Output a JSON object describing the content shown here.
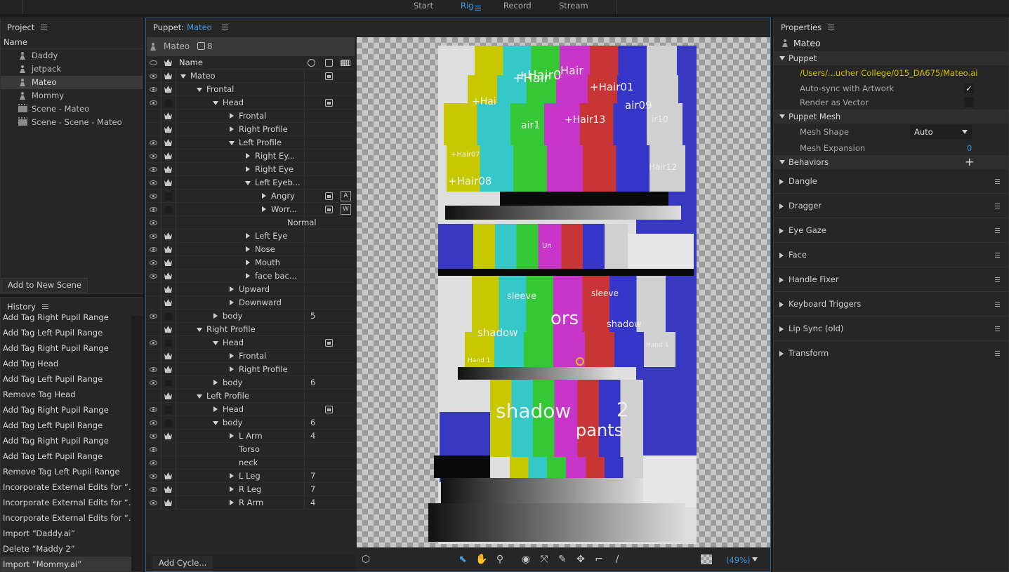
{
  "workspaces": [
    "Start",
    "Rig",
    "Record",
    "Stream"
  ],
  "project": {
    "title": "Project",
    "column": "Name",
    "items": [
      {
        "name": "Daddy",
        "kind": "puppet"
      },
      {
        "name": "jetpack",
        "kind": "puppet"
      },
      {
        "name": "Mateo",
        "kind": "puppet",
        "selected": true
      },
      {
        "name": "Mommy",
        "kind": "puppet"
      },
      {
        "name": "Scene - Mateo",
        "kind": "scene"
      },
      {
        "name": "Scene - Scene - Mateo",
        "kind": "scene"
      }
    ],
    "add_button": "Add to New Scene"
  },
  "history": {
    "title": "History",
    "items": [
      "Add Tag Right Pupil Range",
      "Add Tag Left Pupil Range",
      "Add Tag Right Pupil Range",
      "Add Tag Head",
      "Add Tag Left Pupil Range",
      "Remove Tag Head",
      "Add Tag Right Pupil Range",
      "Add Tag Left Pupil Range",
      "Add Tag Right Pupil Range",
      "Add Tag Left Pupil Range",
      "Remove Tag Left Pupil Range",
      "Incorporate External Edits for “...",
      "Incorporate External Edits for “...",
      "Incorporate External Edits for “...",
      "Import “Daddy.ai”",
      "Delete “Maddy 2”",
      "Import “Mommy.ai”"
    ]
  },
  "puppet_panel": {
    "title_prefix": "Puppet:",
    "title_name": "Mateo",
    "header_name": "Mateo",
    "header_count": "8",
    "column": "Name",
    "add_cycle": "Add Cycle...",
    "zoom": "(49%)"
  },
  "tree": [
    {
      "name": "Mateo",
      "level": 0,
      "exp": "d",
      "eye": true,
      "crown": true,
      "tag": true
    },
    {
      "name": "Frontal",
      "level": 1,
      "exp": "d",
      "eye": true,
      "crown": true
    },
    {
      "name": "Head",
      "level": 2,
      "exp": "d",
      "eye": true,
      "crown": false,
      "tag": true
    },
    {
      "name": "Frontal",
      "level": 3,
      "exp": "r",
      "eye": false,
      "crown": true
    },
    {
      "name": "Right Profile",
      "level": 3,
      "exp": "r",
      "eye": false,
      "crown": true
    },
    {
      "name": "Left Profile",
      "level": 3,
      "exp": "d",
      "eye": true,
      "crown": true
    },
    {
      "name": "Right Ey...",
      "level": 4,
      "exp": "r",
      "eye": true,
      "crown": true
    },
    {
      "name": "Right Eye",
      "level": 4,
      "exp": "r",
      "eye": true,
      "crown": true
    },
    {
      "name": "Left Eyeb...",
      "level": 4,
      "exp": "d",
      "eye": true,
      "crown": true
    },
    {
      "name": "Angry",
      "level": 5,
      "exp": "r",
      "eye": true,
      "crown": false,
      "tag": true,
      "key": "A"
    },
    {
      "name": "Worr...",
      "level": 5,
      "exp": "r",
      "eye": true,
      "crown": false,
      "tag": true,
      "key": "W"
    },
    {
      "name": "Normal",
      "level": 6,
      "exp": "",
      "eye": true,
      "crown": null
    },
    {
      "name": "Left Eye",
      "level": 4,
      "exp": "r",
      "eye": true,
      "crown": true
    },
    {
      "name": "Nose",
      "level": 4,
      "exp": "r",
      "eye": true,
      "crown": true
    },
    {
      "name": "Mouth",
      "level": 4,
      "exp": "r",
      "eye": true,
      "crown": true
    },
    {
      "name": "face bac...",
      "level": 4,
      "exp": "r",
      "eye": true,
      "crown": true
    },
    {
      "name": "Upward",
      "level": 3,
      "exp": "r",
      "eye": false,
      "crown": true
    },
    {
      "name": "Downward",
      "level": 3,
      "exp": "r",
      "eye": false,
      "crown": true
    },
    {
      "name": "body",
      "level": 2,
      "exp": "r",
      "eye": true,
      "crown": false,
      "num": "5"
    },
    {
      "name": "Right Profile",
      "level": 1,
      "exp": "d",
      "eye": false,
      "crown": true
    },
    {
      "name": "Head",
      "level": 2,
      "exp": "d",
      "eye": true,
      "crown": false,
      "tag": true
    },
    {
      "name": "Frontal",
      "level": 3,
      "exp": "r",
      "eye": false,
      "crown": true
    },
    {
      "name": "Right Profile",
      "level": 3,
      "exp": "r",
      "eye": true,
      "crown": true
    },
    {
      "name": "body",
      "level": 2,
      "exp": "r",
      "eye": true,
      "crown": false,
      "num": "6"
    },
    {
      "name": "Left Profile",
      "level": 1,
      "exp": "d",
      "eye": false,
      "crown": true
    },
    {
      "name": "Head",
      "level": 2,
      "exp": "r",
      "eye": true,
      "crown": false,
      "tag": true
    },
    {
      "name": "body",
      "level": 2,
      "exp": "d",
      "eye": true,
      "crown": false,
      "num": "6"
    },
    {
      "name": "L Arm",
      "level": 3,
      "exp": "r",
      "eye": true,
      "crown": true,
      "num": "4"
    },
    {
      "name": "Torso",
      "level": 3,
      "exp": "",
      "eye": true,
      "crown": null
    },
    {
      "name": "neck",
      "level": 3,
      "exp": "",
      "eye": true,
      "crown": null
    },
    {
      "name": "L Leg",
      "level": 3,
      "exp": "r",
      "eye": true,
      "crown": true,
      "num": "7"
    },
    {
      "name": "R Leg",
      "level": 3,
      "exp": "r",
      "eye": true,
      "crown": true,
      "num": "7"
    },
    {
      "name": "R Arm",
      "level": 3,
      "exp": "r",
      "eye": true,
      "crown": true,
      "num": "4"
    }
  ],
  "canvas_labels": [
    "+Hair",
    "+Hair0",
    "Hair",
    "+Hair01",
    "+Hai",
    "air09",
    "+Hair13",
    "air1",
    "ir10",
    "+Hair08",
    "+Hair07",
    "Hair12",
    "sleeve",
    "sleeve",
    "ors",
    "shadow",
    "shadow",
    "Hand 1",
    "Hand 1",
    "shadow",
    "2",
    "pants",
    "Un"
  ],
  "properties": {
    "title": "Properties",
    "name": "Mateo",
    "puppet_section": "Puppet",
    "path": "/Users/...ucher College/015_DA675/Mateo.ai",
    "auto_sync": "Auto-sync with Artwork",
    "render_vector": "Render as Vector",
    "mesh_section": "Puppet Mesh",
    "mesh_shape_label": "Mesh Shape",
    "mesh_shape_value": "Auto",
    "mesh_expansion_label": "Mesh Expansion",
    "mesh_expansion_value": "0",
    "behaviors_section": "Behaviors",
    "behaviors": [
      "Dangle",
      "Dragger",
      "Eye Gaze",
      "Face",
      "Handle Fixer",
      "Keyboard Triggers",
      "Lip Sync (old)",
      "Transform"
    ]
  },
  "colors": {
    "accent": "#3f9ce6",
    "path": "#d4c200"
  }
}
